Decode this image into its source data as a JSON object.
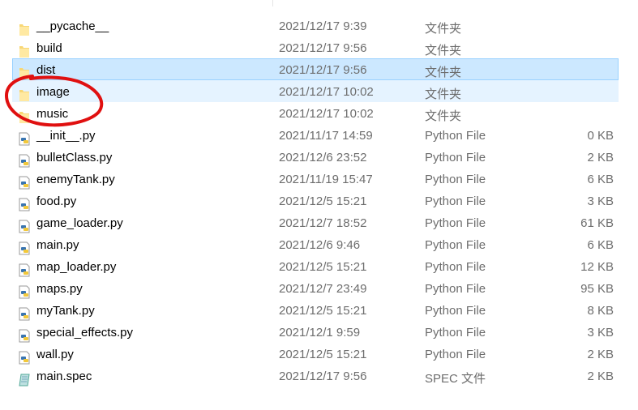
{
  "files": [
    {
      "name": "__pycache__",
      "date": "2021/12/17 9:39",
      "type": "文件夹",
      "size": "",
      "icon": "folder-icon"
    },
    {
      "name": "build",
      "date": "2021/12/17 9:56",
      "type": "文件夹",
      "size": "",
      "icon": "folder-icon"
    },
    {
      "name": "dist",
      "date": "2021/12/17 9:56",
      "type": "文件夹",
      "size": "",
      "icon": "folder-icon",
      "state": "selected"
    },
    {
      "name": "image",
      "date": "2021/12/17 10:02",
      "type": "文件夹",
      "size": "",
      "icon": "folder-icon",
      "state": "hover"
    },
    {
      "name": "music",
      "date": "2021/12/17 10:02",
      "type": "文件夹",
      "size": "",
      "icon": "folder-icon"
    },
    {
      "name": "__init__.py",
      "date": "2021/11/17 14:59",
      "type": "Python File",
      "size": "0 KB",
      "icon": "python-file-icon"
    },
    {
      "name": "bulletClass.py",
      "date": "2021/12/6 23:52",
      "type": "Python File",
      "size": "2 KB",
      "icon": "python-file-icon"
    },
    {
      "name": "enemyTank.py",
      "date": "2021/11/19 15:47",
      "type": "Python File",
      "size": "6 KB",
      "icon": "python-file-icon"
    },
    {
      "name": "food.py",
      "date": "2021/12/5 15:21",
      "type": "Python File",
      "size": "3 KB",
      "icon": "python-file-icon"
    },
    {
      "name": "game_loader.py",
      "date": "2021/12/7 18:52",
      "type": "Python File",
      "size": "61 KB",
      "icon": "python-file-icon"
    },
    {
      "name": "main.py",
      "date": "2021/12/6 9:46",
      "type": "Python File",
      "size": "6 KB",
      "icon": "python-file-icon"
    },
    {
      "name": "map_loader.py",
      "date": "2021/12/5 15:21",
      "type": "Python File",
      "size": "12 KB",
      "icon": "python-file-icon"
    },
    {
      "name": "maps.py",
      "date": "2021/12/7 23:49",
      "type": "Python File",
      "size": "95 KB",
      "icon": "python-file-icon"
    },
    {
      "name": "myTank.py",
      "date": "2021/12/5 15:21",
      "type": "Python File",
      "size": "8 KB",
      "icon": "python-file-icon"
    },
    {
      "name": "special_effects.py",
      "date": "2021/12/1 9:59",
      "type": "Python File",
      "size": "3 KB",
      "icon": "python-file-icon"
    },
    {
      "name": "wall.py",
      "date": "2021/12/5 15:21",
      "type": "Python File",
      "size": "2 KB",
      "icon": "python-file-icon"
    },
    {
      "name": "main.spec",
      "date": "2021/12/17 9:56",
      "type": "SPEC 文件",
      "size": "2 KB",
      "icon": "spec-file-icon"
    }
  ],
  "colors": {
    "selected": "#cce8ff",
    "hover": "#e5f3ff",
    "annotation": "#e01010"
  }
}
